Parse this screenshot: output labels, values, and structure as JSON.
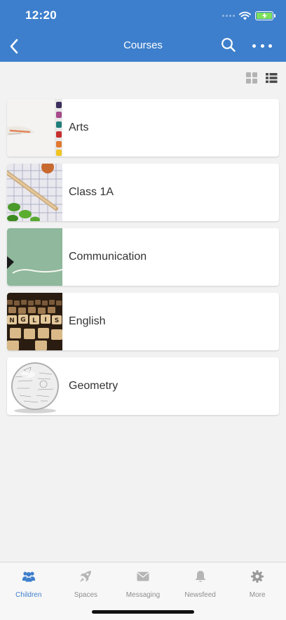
{
  "status_bar": {
    "time": "12:20",
    "battery_charging": true
  },
  "header": {
    "title": "Courses",
    "back_icon": "chevron-left-icon",
    "search_icon": "search-icon",
    "more_icon": "more-horizontal-icon",
    "background": "#3d7fcc"
  },
  "view_toggle": {
    "options": [
      "grid",
      "list"
    ],
    "selected": "list"
  },
  "courses": [
    {
      "name": "Arts",
      "thumbnail": "watercolor-palette"
    },
    {
      "name": "Class 1A",
      "thumbnail": "pencil-beans-grid"
    },
    {
      "name": "Communication",
      "thumbnail": "chalkboard"
    },
    {
      "name": "English",
      "thumbnail": "letter-tiles"
    },
    {
      "name": "Geometry",
      "thumbnail": "formula-sphere"
    }
  ],
  "tabbar": {
    "items": [
      {
        "label": "Children",
        "icon": "people-icon",
        "active": true
      },
      {
        "label": "Spaces",
        "icon": "rocket-icon",
        "active": false
      },
      {
        "label": "Messaging",
        "icon": "envelope-icon",
        "active": false
      },
      {
        "label": "Newsfeed",
        "icon": "bell-icon",
        "active": false
      },
      {
        "label": "More",
        "icon": "gear-icon",
        "active": false
      }
    ],
    "active_color": "#3d7fcc",
    "inactive_color": "#8e8e8e"
  }
}
